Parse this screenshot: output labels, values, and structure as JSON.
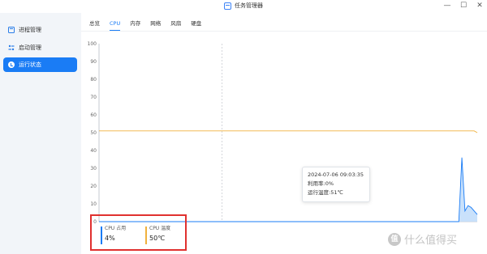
{
  "window": {
    "title": "任务管理器",
    "controls": {
      "minimize": "—",
      "maximize": "☐",
      "close": "✕"
    }
  },
  "sidebar": {
    "items": [
      {
        "label": "进程管理",
        "icon": "process-icon",
        "active": false
      },
      {
        "label": "启动管理",
        "icon": "startup-icon",
        "active": false
      },
      {
        "label": "运行状态",
        "icon": "status-icon",
        "active": true
      }
    ]
  },
  "tabs": [
    {
      "label": "总览",
      "active": false
    },
    {
      "label": "CPU",
      "active": true
    },
    {
      "label": "内存",
      "active": false
    },
    {
      "label": "网络",
      "active": false
    },
    {
      "label": "风扇",
      "active": false
    },
    {
      "label": "硬盘",
      "active": false
    }
  ],
  "legend": {
    "usage": {
      "label": "CPU 占用",
      "value": "4%",
      "color": "#1a7cf5"
    },
    "temp": {
      "label": "CPU 温度",
      "value": "50℃",
      "color": "#f0b13c"
    }
  },
  "tooltip": {
    "time": "2024-07-06 09:03:35",
    "usage": "利用率:0%",
    "temp": "运行温度:51℃"
  },
  "watermark": {
    "badge": "值",
    "text": "什么值得买"
  },
  "chart_data": {
    "type": "area",
    "ylim": [
      0,
      100
    ],
    "yticks": [
      0,
      10,
      20,
      30,
      40,
      50,
      60,
      70,
      80,
      90,
      100
    ],
    "hover_index": 40,
    "series": [
      {
        "color": "#1a7cf5",
        "values": [
          0,
          0,
          0,
          0,
          0,
          0,
          0,
          0,
          0,
          0,
          0,
          0,
          0,
          0,
          0,
          0,
          0,
          0,
          0,
          0,
          0,
          0,
          0,
          0,
          0,
          0,
          0,
          0,
          0,
          0,
          0,
          0,
          0,
          0,
          0,
          0,
          0,
          0,
          0,
          0,
          0,
          0,
          0,
          0,
          0,
          0,
          0,
          0,
          0,
          0,
          0,
          0,
          0,
          0,
          0,
          0,
          0,
          0,
          0,
          0,
          0,
          0,
          0,
          0,
          0,
          0,
          0,
          0,
          0,
          0,
          0,
          0,
          0,
          0,
          0,
          0,
          0,
          0,
          0,
          0,
          0,
          0,
          0,
          0,
          0,
          0,
          0,
          0,
          0,
          0,
          0,
          0,
          0,
          0,
          0,
          0,
          0,
          0,
          0,
          0,
          0,
          0,
          0,
          0,
          0,
          0,
          0,
          0,
          0,
          0,
          0,
          0,
          0,
          0,
          0,
          0,
          0,
          0,
          36,
          6,
          9,
          8,
          6,
          4
        ]
      },
      {
        "color": "#f0b13c",
        "values": [
          51,
          51,
          51,
          51,
          51,
          51,
          51,
          51,
          51,
          51,
          51,
          51,
          51,
          51,
          51,
          51,
          51,
          51,
          51,
          51,
          51,
          51,
          51,
          51,
          51,
          51,
          51,
          51,
          51,
          51,
          51,
          51,
          51,
          51,
          51,
          51,
          51,
          51,
          51,
          51,
          51,
          51,
          51,
          51,
          51,
          51,
          51,
          51,
          51,
          51,
          51,
          51,
          51,
          51,
          51,
          51,
          51,
          51,
          51,
          51,
          51,
          51,
          51,
          51,
          51,
          51,
          51,
          51,
          51,
          51,
          51,
          51,
          51,
          51,
          51,
          51,
          51,
          51,
          51,
          51,
          51,
          51,
          51,
          51,
          51,
          51,
          51,
          51,
          51,
          51,
          51,
          51,
          51,
          51,
          51,
          51,
          51,
          51,
          51,
          51,
          51,
          51,
          51,
          51,
          51,
          51,
          51,
          51,
          51,
          51,
          51,
          51,
          51,
          51,
          51,
          51,
          51,
          51,
          51,
          51,
          51,
          51,
          51,
          50
        ]
      }
    ]
  }
}
